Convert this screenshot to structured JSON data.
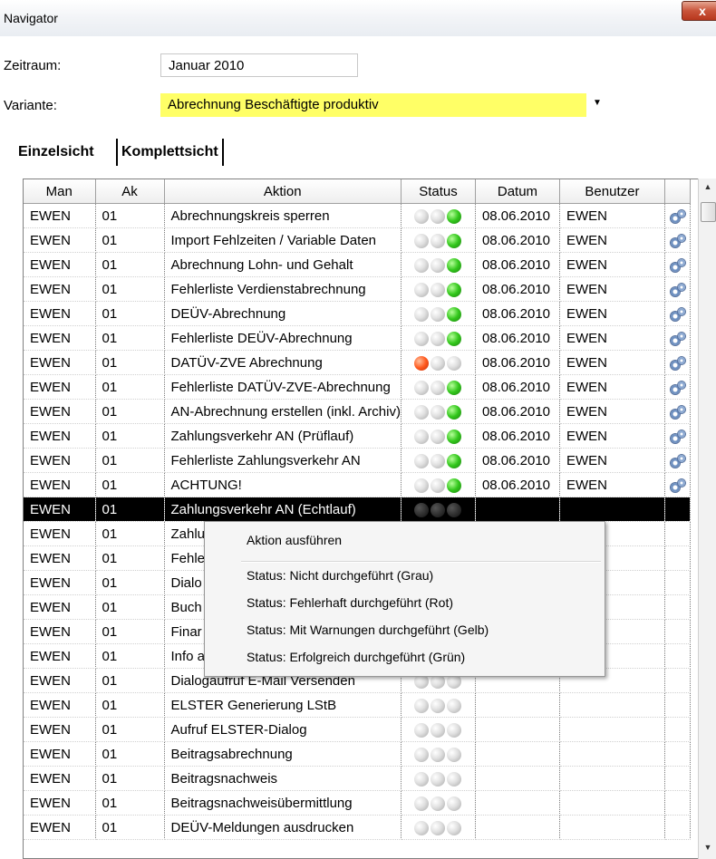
{
  "window": {
    "title": "Navigator",
    "close_label": "x"
  },
  "form": {
    "zeitraum_label": "Zeitraum:",
    "zeitraum_value": "Januar 2010",
    "variante_label": "Variante:",
    "variante_value": "Abrechnung Beschäftigte produktiv",
    "highlight_color": "#ffff66"
  },
  "tabs": [
    "Einzelsicht",
    "Komplettsicht"
  ],
  "table": {
    "columns": [
      "Man",
      "Ak",
      "Aktion",
      "Status",
      "Datum",
      "Benutzer",
      ""
    ],
    "rows": [
      {
        "man": "EWEN",
        "ak": "01",
        "aktion": "Abrechnungskreis sperren",
        "status": "green",
        "datum": "08.06.2010",
        "benutzer": "EWEN",
        "gear": true
      },
      {
        "man": "EWEN",
        "ak": "01",
        "aktion": "Import Fehlzeiten / Variable Daten",
        "status": "green",
        "datum": "08.06.2010",
        "benutzer": "EWEN",
        "gear": true
      },
      {
        "man": "EWEN",
        "ak": "01",
        "aktion": "Abrechnung Lohn- und Gehalt",
        "status": "green",
        "datum": "08.06.2010",
        "benutzer": "EWEN",
        "gear": true
      },
      {
        "man": "EWEN",
        "ak": "01",
        "aktion": "Fehlerliste Verdienstabrechnung",
        "status": "green",
        "datum": "08.06.2010",
        "benutzer": "EWEN",
        "gear": true
      },
      {
        "man": "EWEN",
        "ak": "01",
        "aktion": "DEÜV-Abrechnung",
        "status": "green",
        "datum": "08.06.2010",
        "benutzer": "EWEN",
        "gear": true
      },
      {
        "man": "EWEN",
        "ak": "01",
        "aktion": "Fehlerliste DEÜV-Abrechnung",
        "status": "green",
        "datum": "08.06.2010",
        "benutzer": "EWEN",
        "gear": true
      },
      {
        "man": "EWEN",
        "ak": "01",
        "aktion": "DATÜV-ZVE Abrechnung",
        "status": "red",
        "datum": "08.06.2010",
        "benutzer": "EWEN",
        "gear": true
      },
      {
        "man": "EWEN",
        "ak": "01",
        "aktion": "Fehlerliste DATÜV-ZVE-Abrechnung",
        "status": "green",
        "datum": "08.06.2010",
        "benutzer": "EWEN",
        "gear": true
      },
      {
        "man": "EWEN",
        "ak": "01",
        "aktion": "AN-Abrechnung erstellen (inkl. Archiv)",
        "status": "green",
        "datum": "08.06.2010",
        "benutzer": "EWEN",
        "gear": true
      },
      {
        "man": "EWEN",
        "ak": "01",
        "aktion": "Zahlungsverkehr AN (Prüflauf)",
        "status": "green",
        "datum": "08.06.2010",
        "benutzer": "EWEN",
        "gear": true
      },
      {
        "man": "EWEN",
        "ak": "01",
        "aktion": "Fehlerliste Zahlungsverkehr AN",
        "status": "green",
        "datum": "08.06.2010",
        "benutzer": "EWEN",
        "gear": true
      },
      {
        "man": "EWEN",
        "ak": "01",
        "aktion": "ACHTUNG!",
        "status": "green",
        "datum": "08.06.2010",
        "benutzer": "EWEN",
        "gear": true
      },
      {
        "man": "EWEN",
        "ak": "01",
        "aktion": "Zahlungsverkehr AN (Echtlauf)",
        "status": "none",
        "datum": "",
        "benutzer": "",
        "gear": false,
        "selected": true
      },
      {
        "man": "EWEN",
        "ak": "01",
        "aktion": "Zahlu",
        "status": "none",
        "datum": "",
        "benutzer": "",
        "gear": false
      },
      {
        "man": "EWEN",
        "ak": "01",
        "aktion": "Fehle",
        "status": "none",
        "datum": "",
        "benutzer": "",
        "gear": false
      },
      {
        "man": "EWEN",
        "ak": "01",
        "aktion": "Dialo",
        "status": "none",
        "datum": "",
        "benutzer": "",
        "gear": false
      },
      {
        "man": "EWEN",
        "ak": "01",
        "aktion": "Buch",
        "status": "none",
        "datum": "",
        "benutzer": "",
        "gear": false
      },
      {
        "man": "EWEN",
        "ak": "01",
        "aktion": "Finar",
        "status": "none",
        "datum": "",
        "benutzer": "",
        "gear": false
      },
      {
        "man": "EWEN",
        "ak": "01",
        "aktion": "Info a",
        "status": "none",
        "datum": "",
        "benutzer": "",
        "gear": false
      },
      {
        "man": "EWEN",
        "ak": "01",
        "aktion": "Dialogaufruf E-Mail Versenden",
        "status": "none",
        "datum": "",
        "benutzer": "",
        "gear": false
      },
      {
        "man": "EWEN",
        "ak": "01",
        "aktion": "ELSTER Generierung LStB",
        "status": "none",
        "datum": "",
        "benutzer": "",
        "gear": false
      },
      {
        "man": "EWEN",
        "ak": "01",
        "aktion": "Aufruf ELSTER-Dialog",
        "status": "none",
        "datum": "",
        "benutzer": "",
        "gear": false
      },
      {
        "man": "EWEN",
        "ak": "01",
        "aktion": "Beitragsabrechnung",
        "status": "none",
        "datum": "",
        "benutzer": "",
        "gear": false
      },
      {
        "man": "EWEN",
        "ak": "01",
        "aktion": "Beitragsnachweis",
        "status": "none",
        "datum": "",
        "benutzer": "",
        "gear": false
      },
      {
        "man": "EWEN",
        "ak": "01",
        "aktion": "Beitragsnachweisübermittlung",
        "status": "none",
        "datum": "",
        "benutzer": "",
        "gear": false
      },
      {
        "man": "EWEN",
        "ak": "01",
        "aktion": "DEÜV-Meldungen ausdrucken",
        "status": "none",
        "datum": "",
        "benutzer": "",
        "gear": false
      }
    ]
  },
  "context_menu": {
    "items": [
      "Aktion ausführen",
      "Status: Nicht durchgeführt (Grau)",
      "Status: Fehlerhaft durchgeführt (Rot)",
      "Status: Mit Warnungen durchgeführt (Gelb)",
      "Status: Erfolgreich durchgeführt (Grün)"
    ]
  }
}
